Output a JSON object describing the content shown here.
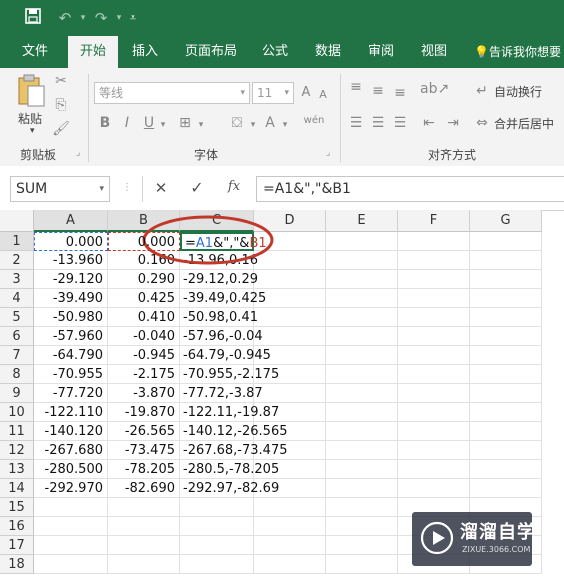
{
  "colors": {
    "brand": "#217346",
    "ref_a": "#2f6fd1",
    "ref_b": "#c0392b",
    "highlight_ring": "#c0392b"
  },
  "quick_access": {
    "save_icon": "save-icon",
    "undo_icon": "undo-icon",
    "redo_icon": "redo-icon",
    "customize_icon": "customize-icon"
  },
  "tabs": [
    "文件",
    "开始",
    "插入",
    "页面布局",
    "公式",
    "数据",
    "审阅",
    "视图"
  ],
  "tell_me": "告诉我你想要",
  "ribbon": {
    "clipboard": {
      "paste_label": "粘贴",
      "group_label": "剪贴板"
    },
    "font": {
      "font_name": "等线",
      "font_size": "11",
      "bold": "B",
      "italic": "I",
      "underline": "U",
      "group_label": "字体"
    },
    "alignment": {
      "wrap_text": "自动换行",
      "merge_center": "合并后居中",
      "group_label": "对齐方式"
    }
  },
  "formula_bar": {
    "name_box": "SUM",
    "cancel": "✕",
    "enter": "✓",
    "fx": "fx",
    "formula": "=A1&\",\"&B1"
  },
  "columns": [
    "A",
    "B",
    "C",
    "D",
    "E",
    "F",
    "G"
  ],
  "rows": [
    "1",
    "2",
    "3",
    "4",
    "5",
    "6",
    "7",
    "8",
    "9",
    "10",
    "11",
    "12",
    "13",
    "14",
    "15",
    "16",
    "17",
    "18"
  ],
  "data_rows": [
    {
      "a": "0.000",
      "b": "0.000",
      "c": "=A1&\",\"&B1"
    },
    {
      "a": "-13.960",
      "b": "0.160",
      "c": "-13.96,0.16"
    },
    {
      "a": "-29.120",
      "b": "0.290",
      "c": "-29.12,0.29"
    },
    {
      "a": "-39.490",
      "b": "0.425",
      "c": "-39.49,0.425"
    },
    {
      "a": "-50.980",
      "b": "0.410",
      "c": "-50.98,0.41"
    },
    {
      "a": "-57.960",
      "b": "-0.040",
      "c": "-57.96,-0.04"
    },
    {
      "a": "-64.790",
      "b": "-0.945",
      "c": "-64.79,-0.945"
    },
    {
      "a": "-70.955",
      "b": "-2.175",
      "c": "-70.955,-2.175"
    },
    {
      "a": "-77.720",
      "b": "-3.870",
      "c": "-77.72,-3.87"
    },
    {
      "a": "-122.110",
      "b": "-19.870",
      "c": "-122.11,-19.87"
    },
    {
      "a": "-140.120",
      "b": "-26.565",
      "c": "-140.12,-26.565"
    },
    {
      "a": "-267.680",
      "b": "-73.475",
      "c": "-267.68,-73.475"
    },
    {
      "a": "-280.500",
      "b": "-78.205",
      "c": "-280.5,-78.205"
    },
    {
      "a": "-292.970",
      "b": "-82.690",
      "c": "-292.97,-82.69"
    }
  ],
  "watermark": {
    "brand": "溜溜自学",
    "url": "ZIXUE.3066.COM"
  }
}
